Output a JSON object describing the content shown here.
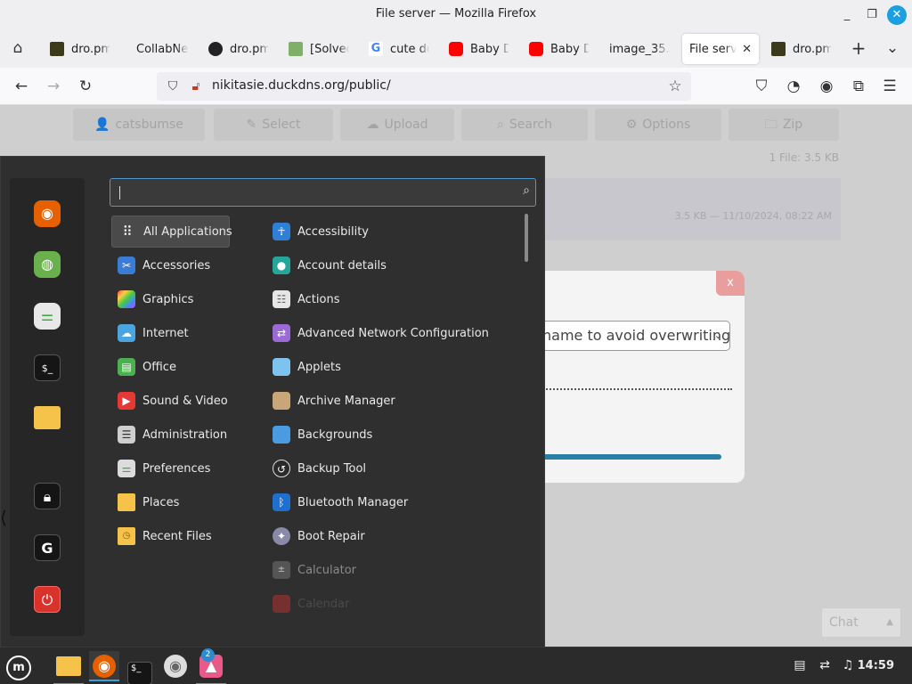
{
  "window": {
    "title": "File server — Mozilla Firefox",
    "controls": [
      "_",
      "❐",
      "✕"
    ]
  },
  "tabs": [
    {
      "label": "dro.pm/",
      "favicon_color": "#3b3b1b"
    },
    {
      "label": "CollabNet",
      "favicon_color": "#efeef1"
    },
    {
      "label": "dro.pm/",
      "favicon_color": "#222222"
    },
    {
      "label": "[Solved]",
      "favicon_color": "#7fb069"
    },
    {
      "label": "cute do",
      "favicon_color": "#4285f4"
    },
    {
      "label": "Baby D",
      "favicon_color": "#ff0000"
    },
    {
      "label": "Baby Do",
      "favicon_color": "#ff0000"
    },
    {
      "label": "image_35.p",
      "favicon_color": "#efeef1"
    },
    {
      "label": "File serv",
      "favicon_color": "#ffffff",
      "active": true
    },
    {
      "label": "dro.pm/",
      "favicon_color": "#3b3b1b"
    }
  ],
  "tab_controls": {
    "new_tab": "+",
    "list_tabs": "⌄"
  },
  "nav": {
    "url": "nikitasie.duckdns.org/public/",
    "back": "←",
    "forward": "→",
    "reload": "↻"
  },
  "page": {
    "toolbar": [
      {
        "label": "catsbumse",
        "icon": "👤"
      },
      {
        "label": "Select",
        "icon": "✎"
      },
      {
        "label": "Upload",
        "icon": "☁"
      },
      {
        "label": "Search",
        "icon": "⌕"
      },
      {
        "label": "Options",
        "icon": "⚙"
      },
      {
        "label": "Zip",
        "icon": "🗀"
      }
    ],
    "file_count": "1 File: 3.5 KB",
    "file_meta": "3.5 KB — 11/10/2024, 08:22 AM",
    "dialog": {
      "close": "x",
      "select_value": "name to avoid overwriting",
      "progress": 1.0
    },
    "chat_label": "Chat",
    "chat_arrow": "▲"
  },
  "menu": {
    "search_placeholder": "",
    "favorites": [
      {
        "name": "firefox",
        "color": "#e66000",
        "glyph": "🦊"
      },
      {
        "name": "web-browser",
        "color": "#6ab04c",
        "glyph": "◍"
      },
      {
        "name": "settings-toggle",
        "color": "#9bd16a",
        "glyph": "⚌"
      },
      {
        "name": "terminal",
        "color": "#1e1e1e",
        "glyph": "$_"
      },
      {
        "name": "files-folder",
        "color": "#f5c24a",
        "glyph": ""
      },
      {
        "name": "lock-screen",
        "color": "#1e1e1e",
        "glyph": "🔒"
      },
      {
        "name": "logout",
        "color": "#1e1e1e",
        "glyph": "G"
      },
      {
        "name": "power",
        "color": "#d9322b",
        "glyph": "⏻"
      }
    ],
    "categories": [
      {
        "label": "All Applications",
        "icon": "grid",
        "color": "#444444",
        "selected": true
      },
      {
        "label": "Accessories",
        "icon": "scissors",
        "color": "#3a7bd5"
      },
      {
        "label": "Graphics",
        "icon": "palette",
        "color": "#c44ad6"
      },
      {
        "label": "Internet",
        "icon": "cloud",
        "color": "#4aa5e0"
      },
      {
        "label": "Office",
        "icon": "doc",
        "color": "#4caf50"
      },
      {
        "label": "Sound & Video",
        "icon": "play",
        "color": "#e53935"
      },
      {
        "label": "Administration",
        "icon": "sliders",
        "color": "#9e9e9e"
      },
      {
        "label": "Preferences",
        "icon": "toggles",
        "color": "#8bc34a"
      },
      {
        "label": "Places",
        "icon": "folder",
        "color": "#f5c24a"
      },
      {
        "label": "Recent Files",
        "icon": "folder-clock",
        "color": "#f5c24a"
      }
    ],
    "apps": [
      {
        "label": "Accessibility",
        "icon": "person",
        "color": "#2f7fd6"
      },
      {
        "label": "Account details",
        "icon": "user-card",
        "color": "#26a69a"
      },
      {
        "label": "Actions",
        "icon": "list",
        "color": "#cfcfcf"
      },
      {
        "label": "Advanced Network Configuration",
        "icon": "network",
        "color": "#9c6ad6"
      },
      {
        "label": "Applets",
        "icon": "window",
        "color": "#7ec3ee"
      },
      {
        "label": "Archive Manager",
        "icon": "box",
        "color": "#c8a678"
      },
      {
        "label": "Backgrounds",
        "icon": "image",
        "color": "#4a9be0"
      },
      {
        "label": "Backup Tool",
        "icon": "backup",
        "color": "#2a2a2a"
      },
      {
        "label": "Bluetooth Manager",
        "icon": "bluetooth",
        "color": "#1e6fd0"
      },
      {
        "label": "Boot Repair",
        "icon": "wrench",
        "color": "#6a6a8a"
      },
      {
        "label": "Calculator",
        "icon": "calculator",
        "color": "#555555",
        "state": "dim"
      },
      {
        "label": "Calendar",
        "icon": "calendar",
        "color": "#a83232",
        "state": "faded"
      }
    ]
  },
  "panel": {
    "taskbar": [
      {
        "name": "files",
        "glyph": "",
        "color": "#f5c24a"
      },
      {
        "name": "firefox",
        "glyph": "🦊",
        "color": "#e66000",
        "active": true
      },
      {
        "name": "terminal",
        "glyph": "$_",
        "color": "#1e1e1e"
      },
      {
        "name": "disc",
        "glyph": "◉",
        "color": "#dddddd"
      },
      {
        "name": "image-viewer",
        "glyph": "▲",
        "color": "#e85a8a",
        "badge": "2"
      }
    ],
    "clock": "14:59"
  }
}
